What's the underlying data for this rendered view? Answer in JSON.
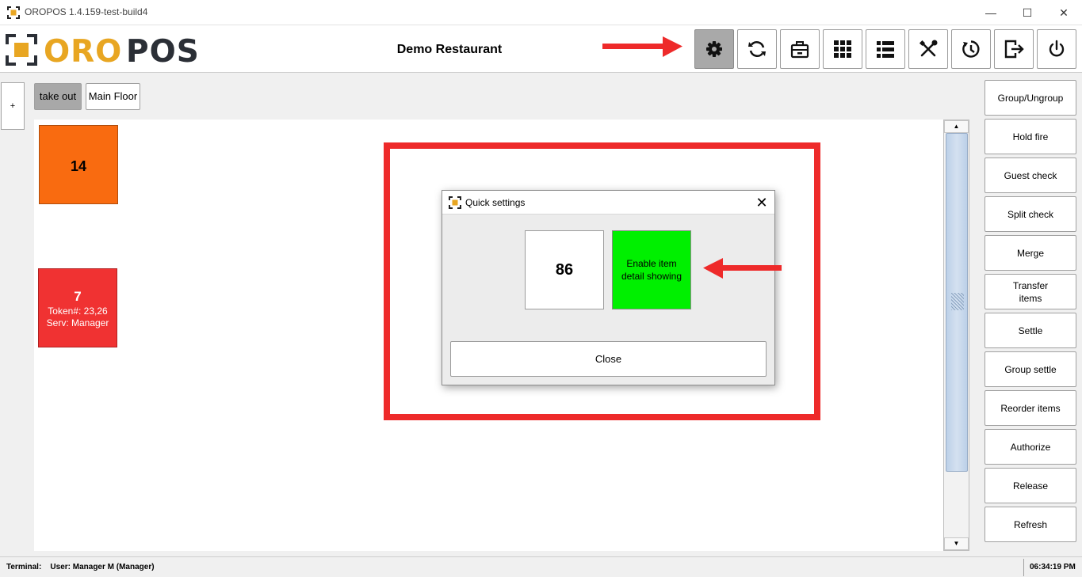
{
  "window": {
    "title": "OROPOS 1.4.159-test-build4",
    "controls": [
      "—",
      "☐",
      "✕"
    ]
  },
  "header": {
    "logo_text_accent": "ORO",
    "logo_text_main": "POS",
    "restaurant_name": "Demo Restaurant",
    "toolbar_icons": [
      "gear-icon",
      "refresh-icon",
      "cash-drawer-icon",
      "grid-icon",
      "list-icon",
      "tools-icon",
      "clock-icon",
      "logout-icon",
      "power-icon"
    ]
  },
  "left_panel": {
    "add_label": "+"
  },
  "floor_tabs": [
    {
      "label": "take out",
      "selected": true
    },
    {
      "label": "Main Floor",
      "selected": false
    }
  ],
  "tables": [
    {
      "number": "14",
      "color": "#f96b10",
      "token": "",
      "server": ""
    },
    {
      "number": "7",
      "color": "#f03232",
      "token": "Token#: 23,26",
      "server": "Serv: Manager"
    }
  ],
  "side_buttons": [
    {
      "label": "Group/Ungroup"
    },
    {
      "label": "Hold fire"
    },
    {
      "label": "Guest check"
    },
    {
      "label": "Split check"
    },
    {
      "label": "Merge"
    },
    {
      "label": "Transfer items"
    },
    {
      "label": "Settle"
    },
    {
      "label": "Group settle"
    },
    {
      "label": "Reorder items"
    },
    {
      "label": "Authorize"
    },
    {
      "label": "Release"
    },
    {
      "label": "Refresh"
    }
  ],
  "dialog": {
    "title": "Quick settings",
    "close_icon": "✕",
    "btn_86": "86",
    "btn_enable": "Enable item detail showing",
    "btn_close": "Close"
  },
  "statusbar": {
    "terminal_label": "Terminal:",
    "user": "User: Manager M (Manager)",
    "time": "06:34:19 PM"
  },
  "colors": {
    "accent": "#e8a622",
    "annotation_red": "#ee2a2a",
    "enable_green": "#00f000",
    "table_orange": "#f96b10",
    "table_red": "#f03232"
  }
}
